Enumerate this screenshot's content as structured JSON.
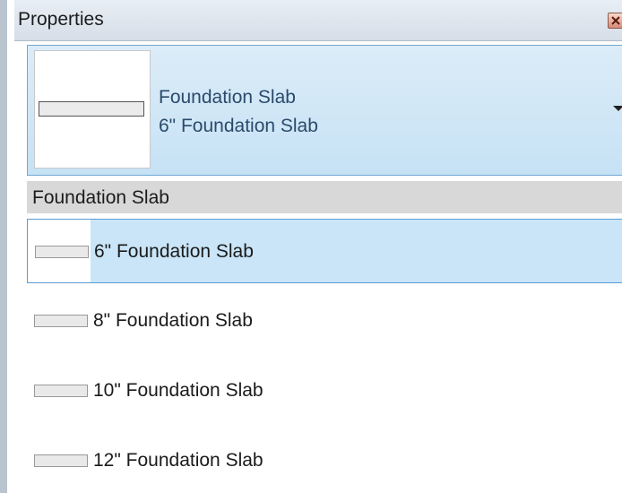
{
  "panel": {
    "title": "Properties",
    "close_icon": "close-icon"
  },
  "type_selector": {
    "family": "Foundation Slab",
    "type": "6\" Foundation Slab",
    "dropdown_icon": "dropdown-arrow-icon"
  },
  "dropdown": {
    "group_header": "Foundation Slab",
    "items": [
      {
        "label": "6\" Foundation Slab",
        "selected": true
      },
      {
        "label": "8\" Foundation Slab",
        "selected": false
      },
      {
        "label": "10\" Foundation Slab",
        "selected": false
      },
      {
        "label": "12\" Foundation Slab",
        "selected": false
      }
    ]
  },
  "colors": {
    "selection": "#c9e5f7",
    "selection_border": "#5a9bd6",
    "header": "#d8d8d8"
  }
}
